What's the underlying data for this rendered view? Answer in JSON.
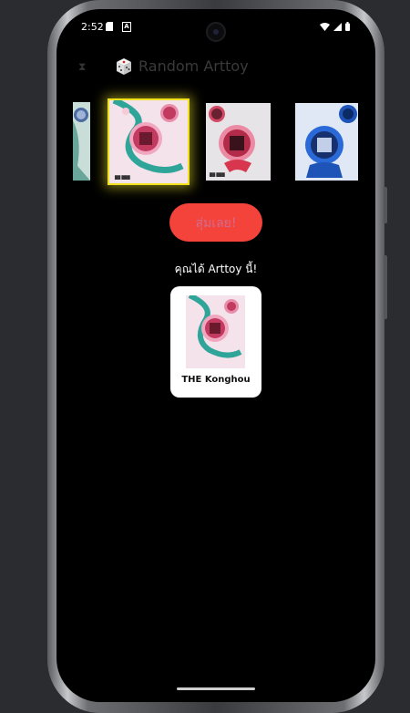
{
  "status_bar": {
    "time": "2:52",
    "notification_letter": "A"
  },
  "app_bar": {
    "title": "Random Arttoy",
    "title_icon": "die-icon",
    "menu_icon": "hourglass-icon"
  },
  "carousel": {
    "items": [
      {
        "name": "teal-arttoy-poster",
        "selected": false
      },
      {
        "name": "pink-arttoy-poster",
        "selected": true
      },
      {
        "name": "red-arttoy-poster",
        "selected": false
      },
      {
        "name": "blue-arttoy-poster",
        "selected": false
      }
    ]
  },
  "random_button": {
    "label": "สุ่มเลย!"
  },
  "result": {
    "heading": "คุณได้ Arttoy นี้!",
    "name": "THE Konghou"
  },
  "colors": {
    "accent": "#f4433a",
    "highlight": "#f2e21d",
    "background": "#000000"
  }
}
